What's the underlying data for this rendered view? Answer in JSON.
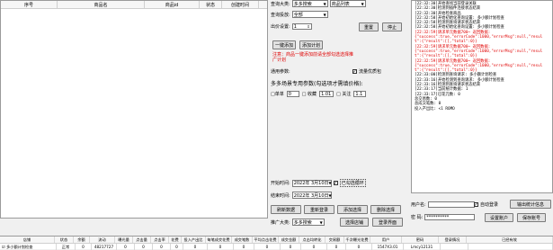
{
  "product_table": {
    "columns": [
      "序号",
      "商品名",
      "商品id",
      "状态",
      "创建时间"
    ]
  },
  "settings": {
    "query_type_label": "查询大类:",
    "query_type_value": "多多搜索",
    "query_sub_value": "商品列表",
    "query_status_label": "查询投放:",
    "query_status_value": "全部",
    "pages_label": "出价设置:",
    "pages_value": "1",
    "reset_button": "重置",
    "stop_button": "停止",
    "add_one_button": "一键添加",
    "add_plan_button": "添加计划",
    "notice": "注意：商品一键添加前请全部勾选选择推广计划",
    "general_params_label": "通用参数:",
    "traffic_check_label": "流量优质包",
    "multi_scene_label": "多多场景专用参数(勾选项才需填价格):",
    "scene_items": [
      {
        "label": "□单单",
        "value": "0"
      },
      {
        "label": "□ 收藏",
        "value": "1.01"
      },
      {
        "label": "□ 关注",
        "value": "1.1"
      }
    ],
    "start_time_label": "开始时间:",
    "start_time_value": "2022年 3月10日",
    "end_time_label": "结束时间:",
    "end_time_value": "2022年 3月10日",
    "loop_check_label": "已勾选循环",
    "refresh_button": "刷新数据",
    "reset_login_button": "重新登录",
    "add_channel_button": "添加选择",
    "delete_button": "删除选择",
    "promo_type_label": "推广大类:",
    "promo_type_value": "多多搜索",
    "channel_button": "选择店铺",
    "login_page_button": "登录界面"
  },
  "log": [
    {
      "text": "[22:32:30]开始查找当前登录关联",
      "red": false
    },
    {
      "text": "[22:32:30]检测到插件连接状态结束",
      "red": false
    },
    {
      "text": "[22:32:30]开始检查商品",
      "red": false
    },
    {
      "text": "[22:32:58]开始初始化查询设置: 多小额计划检查",
      "red": false
    },
    {
      "text": "[22:32:58]检测到查询请求状态结束",
      "red": false
    },
    {
      "text": "[22:32:58]开始初始化查询设置: 多小额计划检查",
      "red": false
    },
    {
      "text": "[22:32:59]请求单元数据700~ 返回数据:",
      "red": true
    },
    {
      "text": "{\"success\":true,\"errorCode\":1000,\"errorMsg\":null,\"resul",
      "red": true
    },
    {
      "text": "t\":{\"result\":[],\"total\":0}}",
      "red": true
    },
    {
      "text": "[22:32:59]请求单元数据700~ 返回数据:",
      "red": true
    },
    {
      "text": "{\"success\":true,\"errorCode\":1000,\"errorMsg\":null,\"resul",
      "red": true
    },
    {
      "text": "t\":{\"result\":[],\"total\":0}}",
      "red": true
    },
    {
      "text": "[22:32:59]请求单元数据700~ 返回数据:",
      "red": true
    },
    {
      "text": "{\"success\":true,\"errorCode\":1000,\"errorMsg\":null,\"resul",
      "red": true
    },
    {
      "text": "t\":{\"result\":[],\"total\":0}}",
      "red": true
    },
    {
      "text": "[22:33:00]检测到查询请求: 多小额计划检查",
      "red": false
    },
    {
      "text": "[22:33:16]开始检测到查询请求: 多小额计划检查",
      "red": false
    },
    {
      "text": "[22:33:16]检测到查询请求状态结束",
      "red": false
    },
    {
      "text": "[22:33:17]当前统计数据: 1",
      "red": false
    },
    {
      "text": "[22:33:17]已花元数: 0",
      "red": false
    },
    {
      "text": "总交易数: 0",
      "red": false
    },
    {
      "text": "总成交笔数: 0",
      "red": false
    },
    {
      "text": "投入产出比: <1 ROMO",
      "red": false
    }
  ],
  "account": {
    "user_label": "用户名:",
    "user_value": "",
    "auto_login_label": "自动登录",
    "export_button": "输出统计信息",
    "password_label": "密 码:",
    "password_value": "**********",
    "set_account_button": "设置账户",
    "save_button": "保存账号"
  },
  "bottom_table": {
    "columns": [
      "店铺",
      "状态",
      "余额",
      "流动",
      "曝光量",
      "点击量",
      "点击率",
      "花费",
      "投入产出比",
      "每笔成交花费",
      "成交笔数",
      "平均点击花费",
      "成交金额",
      "点击均转化",
      "交易额",
      "千次曝光花费",
      "用户",
      "密码",
      "登录情况",
      "已经有效"
    ],
    "row": [
      "☑ 多小额计划检查",
      "正常",
      "0",
      "48217727",
      "0",
      "0",
      "0",
      "0",
      "0",
      "0",
      "0",
      "0",
      "0",
      "0",
      "0",
      "0",
      "1547X3.01",
      "Lmcy12131",
      "",
      ""
    ]
  }
}
